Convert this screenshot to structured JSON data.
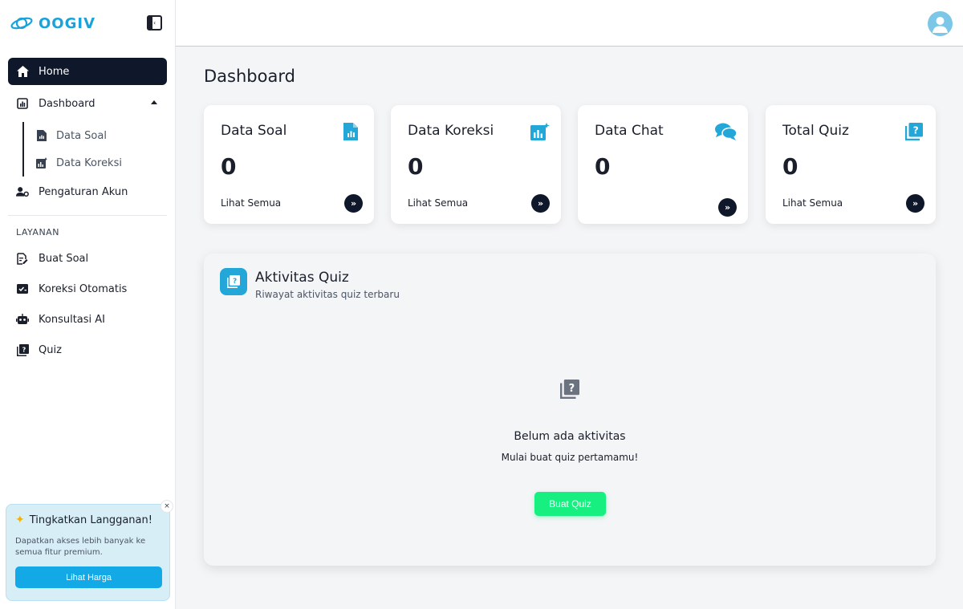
{
  "brand": {
    "name": "OOGIV",
    "color": "#1aa3d9"
  },
  "sidebar": {
    "home": "Home",
    "dashboard": "Dashboard",
    "sub": [
      "Data Soal",
      "Data Koreksi"
    ],
    "account": "Pengaturan Akun",
    "section_label": "LAYANAN",
    "services": [
      "Buat Soal",
      "Koreksi Otomatis",
      "Konsultasi AI",
      "Quiz"
    ]
  },
  "promo": {
    "title": "Tingkatkan Langganan!",
    "text": "Dapatkan akses lebih banyak ke semua fitur premium.",
    "button": "Lihat Harga",
    "close": "×"
  },
  "page": {
    "title": "Dashboard"
  },
  "cards": [
    {
      "label": "Data Soal",
      "value": "0",
      "link": "Lihat Semua",
      "icon": "file-chart-icon"
    },
    {
      "label": "Data Koreksi",
      "value": "0",
      "link": "Lihat Semua",
      "icon": "chart-sparkle-icon"
    },
    {
      "label": "Data Chat",
      "value": "0",
      "link": "",
      "icon": "chat-bubbles-icon"
    },
    {
      "label": "Total Quiz",
      "value": "0",
      "link": "Lihat Semua",
      "icon": "quiz-book-icon"
    }
  ],
  "card_arrow": "»",
  "activity": {
    "title": "Aktivitas Quiz",
    "subtitle": "Riwayat aktivitas quiz terbaru",
    "empty_title": "Belum ada aktivitas",
    "empty_sub": "Mulai buat quiz pertamamu!",
    "button": "Buat Quiz"
  },
  "colors": {
    "accent": "#22a7d8",
    "dark": "#0f172a",
    "success": "#17f080"
  }
}
